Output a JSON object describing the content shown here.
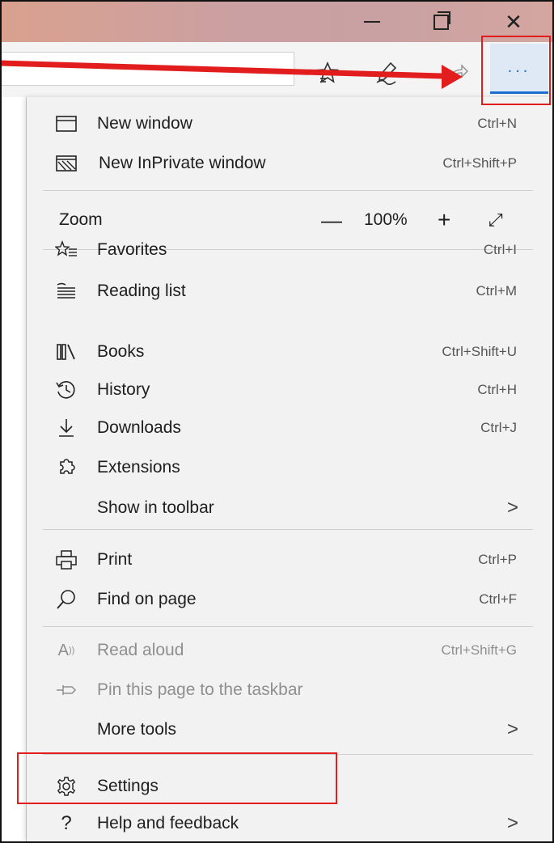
{
  "window": {
    "minimize_icon": "minimize-icon",
    "maximize_icon": "restore-icon",
    "close_label": "✕"
  },
  "toolbar": {
    "more_label": "...",
    "icons": [
      "favorites-star-icon",
      "pen-notes-icon",
      "share-icon"
    ]
  },
  "menu": {
    "new_window": {
      "label": "New window",
      "shortcut": "Ctrl+N"
    },
    "new_inprivate": {
      "label": "New InPrivate window",
      "shortcut": "Ctrl+Shift+P"
    },
    "zoom": {
      "label": "Zoom",
      "minus": "—",
      "value": "100%",
      "plus": "+",
      "fullscreen": "⤢"
    },
    "favorites": {
      "label": "Favorites",
      "shortcut": "Ctrl+I"
    },
    "reading_list": {
      "label": "Reading list",
      "shortcut": "Ctrl+M"
    },
    "books": {
      "label": "Books",
      "shortcut": "Ctrl+Shift+U"
    },
    "history": {
      "label": "History",
      "shortcut": "Ctrl+H"
    },
    "downloads": {
      "label": "Downloads",
      "shortcut": "Ctrl+J"
    },
    "extensions": {
      "label": "Extensions"
    },
    "show_in_toolbar": {
      "label": "Show in toolbar",
      "chevron": ">"
    },
    "print": {
      "label": "Print",
      "shortcut": "Ctrl+P"
    },
    "find_on_page": {
      "label": "Find on page",
      "shortcut": "Ctrl+F"
    },
    "read_aloud": {
      "label": "Read aloud",
      "shortcut": "Ctrl+Shift+G"
    },
    "pin_taskbar": {
      "label": "Pin this page to the taskbar"
    },
    "more_tools": {
      "label": "More tools",
      "chevron": ">"
    },
    "settings": {
      "label": "Settings"
    },
    "help": {
      "label": "Help and feedback",
      "chevron": ">"
    }
  },
  "annotations": {
    "color": "#e21d1d"
  }
}
